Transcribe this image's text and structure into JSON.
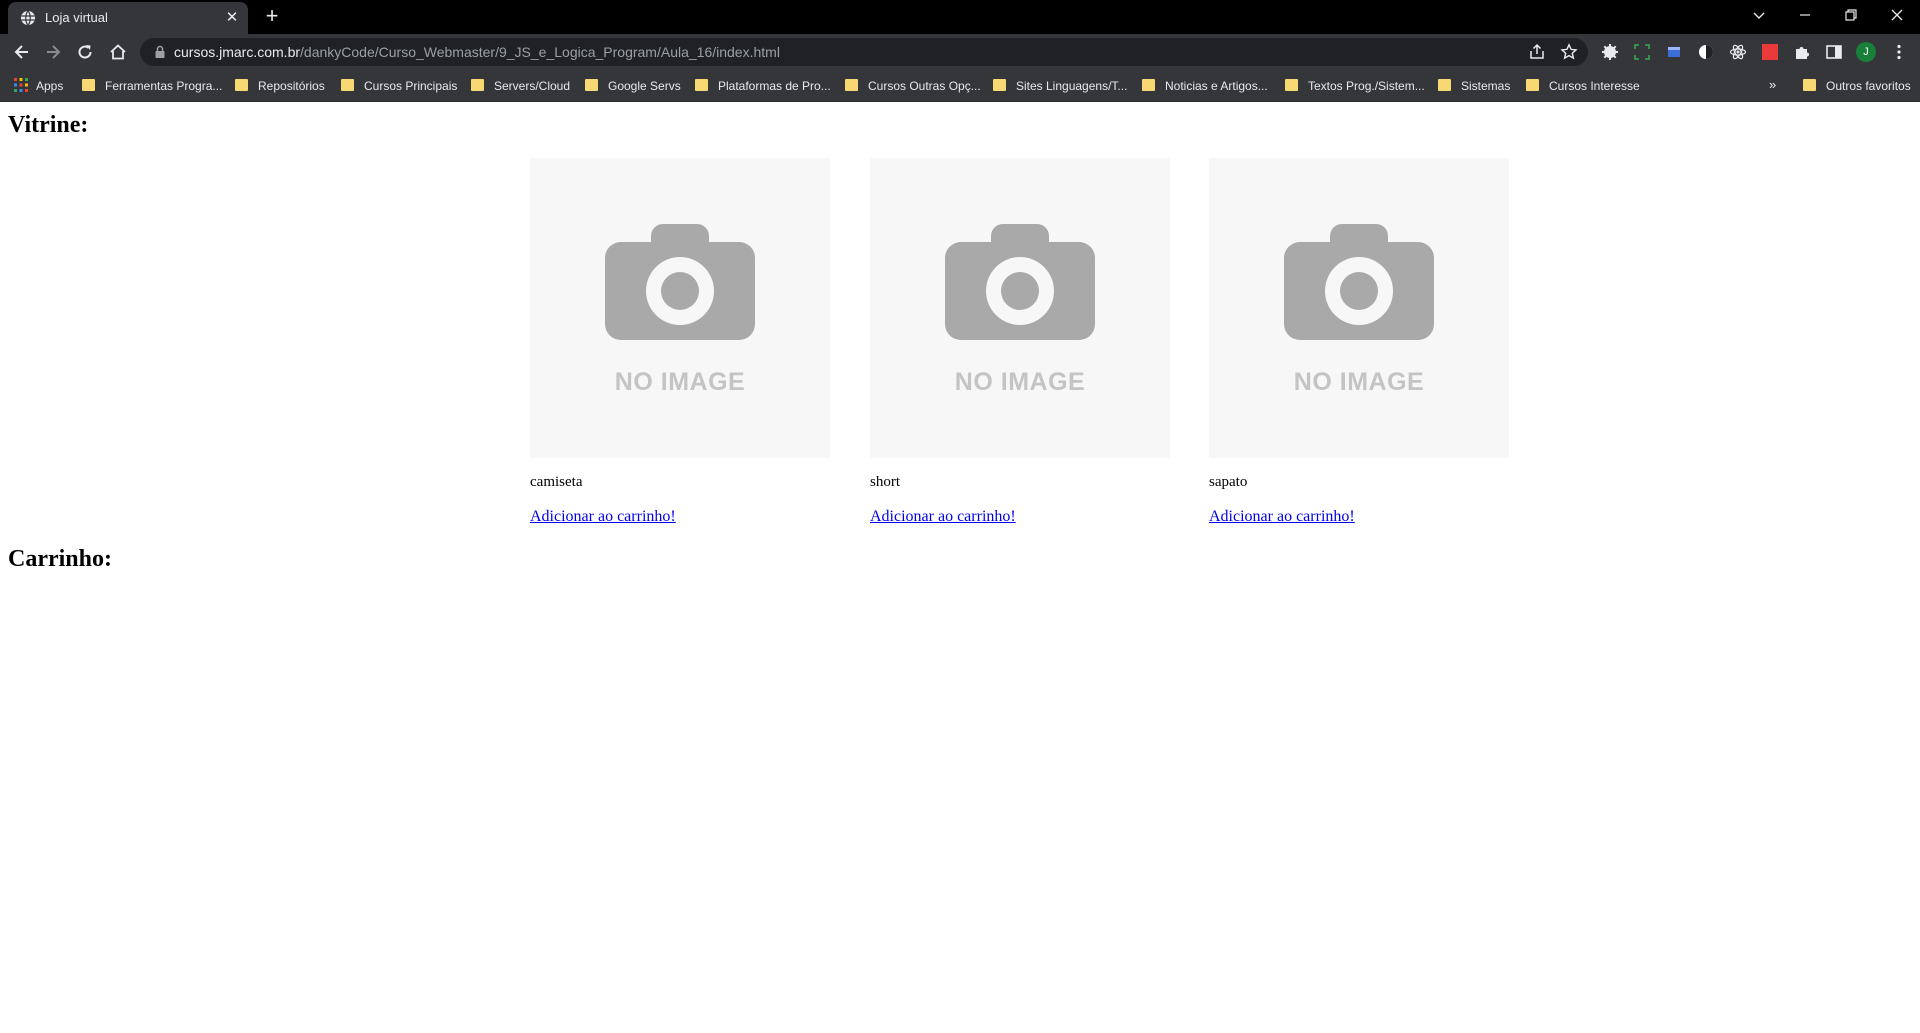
{
  "browser": {
    "tab_title": "Loja virtual",
    "tab_close_glyph": "✕",
    "new_tab_glyph": "+",
    "url_host": "cursos.jmarc.com.br",
    "url_path": "/dankyCode/Curso_Webmaster/9_JS_e_Logica_Program/Aula_16/index.html",
    "profile_initial": "J",
    "bookmarks": [
      {
        "label": "Apps",
        "icon": "apps-grid-icon"
      },
      {
        "label": "Ferramentas Progra...",
        "icon": "folder-icon"
      },
      {
        "label": "Repositórios",
        "icon": "folder-icon"
      },
      {
        "label": "Cursos Principais",
        "icon": "folder-icon"
      },
      {
        "label": "Servers/Cloud",
        "icon": "folder-icon"
      },
      {
        "label": "Google Servs",
        "icon": "folder-icon"
      },
      {
        "label": "Plataformas de Pro...",
        "icon": "folder-icon"
      },
      {
        "label": "Cursos Outras Opç...",
        "icon": "folder-icon"
      },
      {
        "label": "Sites Linguagens/T...",
        "icon": "folder-icon"
      },
      {
        "label": "Noticias e Artigos...",
        "icon": "folder-icon"
      },
      {
        "label": "Textos Prog./Sistem...",
        "icon": "folder-icon"
      },
      {
        "label": "Sistemas",
        "icon": "folder-icon"
      },
      {
        "label": "Cursos Interesse",
        "icon": "folder-icon"
      }
    ],
    "bookmarks_overflow": "»",
    "other_bookmarks": "Outros favoritos",
    "colors": {
      "frame": "#000000",
      "toolbar": "#35363a",
      "omnibox": "#202124",
      "folder": "#f7d873"
    }
  },
  "page": {
    "vitrine_heading": "Vitrine:",
    "carrinho_heading": "Carrinho:",
    "products": [
      {
        "name": "camiseta",
        "placeholder_text": "NO IMAGE",
        "add_link": "Adicionar ao carrinho!"
      },
      {
        "name": "short",
        "placeholder_text": "NO IMAGE",
        "add_link": "Adicionar ao carrinho!"
      },
      {
        "name": "sapato",
        "placeholder_text": "NO IMAGE",
        "add_link": "Adicionar ao carrinho!"
      }
    ]
  }
}
